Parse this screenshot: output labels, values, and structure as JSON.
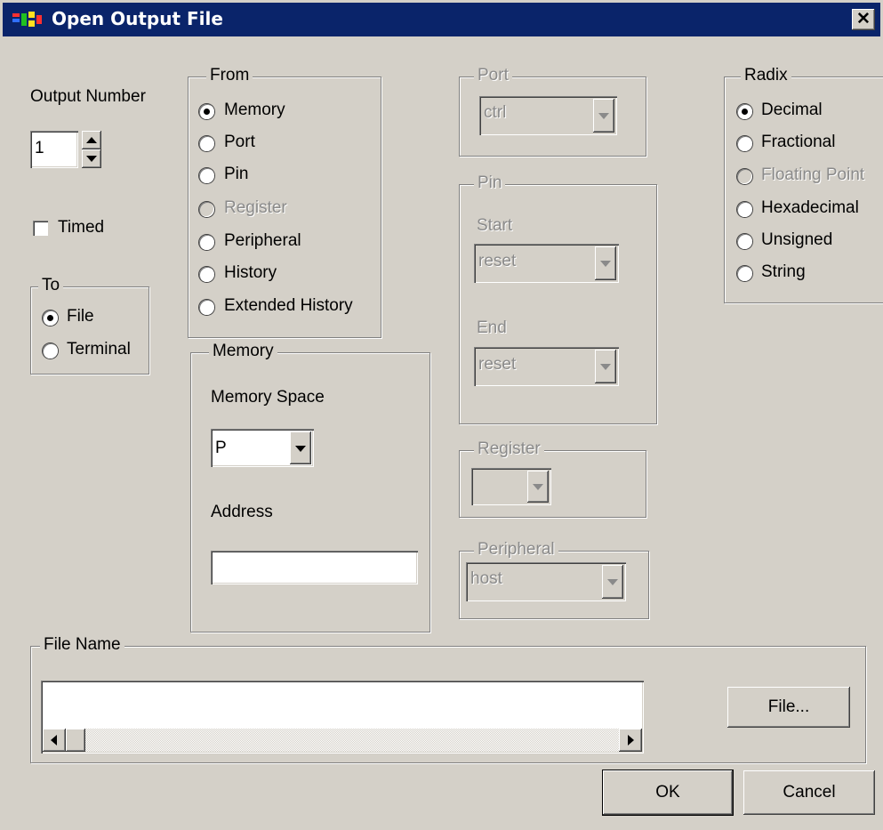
{
  "window": {
    "title": "Open Output File",
    "close_glyph": "✕"
  },
  "output_number": {
    "label": "Output Number",
    "value": "1"
  },
  "timed": {
    "label": "Timed",
    "checked": false
  },
  "to": {
    "legend": "To",
    "options": [
      "File",
      "Terminal"
    ],
    "selected": "File"
  },
  "from": {
    "legend": "From",
    "options": [
      "Memory",
      "Port",
      "Pin",
      "Register",
      "Peripheral",
      "History",
      "Extended History"
    ],
    "selected": "Memory",
    "disabled": [
      "Register"
    ]
  },
  "memory": {
    "legend": "Memory",
    "space_label": "Memory Space",
    "space_value": "P",
    "address_label": "Address",
    "address_value": ""
  },
  "port": {
    "legend": "Port",
    "value": "ctrl"
  },
  "pin": {
    "legend": "Pin",
    "start_label": "Start",
    "start_value": "reset",
    "end_label": "End",
    "end_value": "reset"
  },
  "register": {
    "legend": "Register",
    "value": ""
  },
  "peripheral": {
    "legend": "Peripheral",
    "value": "host"
  },
  "radix": {
    "legend": "Radix",
    "options": [
      "Decimal",
      "Fractional",
      "Floating Point",
      "Hexadecimal",
      "Unsigned",
      "String"
    ],
    "selected": "Decimal",
    "disabled": [
      "Floating Point"
    ]
  },
  "file_name": {
    "legend": "File Name",
    "value": "",
    "file_button": "File..."
  },
  "buttons": {
    "ok": "OK",
    "cancel": "Cancel"
  }
}
